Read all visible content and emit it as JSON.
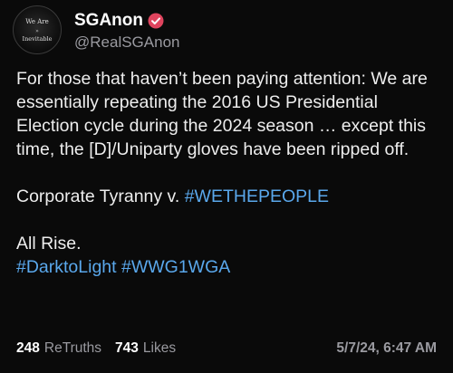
{
  "profile": {
    "display_name": "SGAnon",
    "handle": "@RealSGAnon",
    "avatar_text_top": "We Are",
    "avatar_text_mid": "»",
    "avatar_text_bottom": "Inevitable"
  },
  "post": {
    "paragraph_1": "For those that haven’t been paying attention: We are essentially repeating the 2016 US Presidential Election cycle during the 2024 season … except this time, the [D]/Uniparty gloves have been ripped off.",
    "paragraph_2_prefix": "Corporate Tyranny v. ",
    "paragraph_2_hashtag": "#WETHEPEOPLE",
    "paragraph_3": "All Rise.",
    "hashtag_1": "#DarktoLight",
    "hashtag_2": "#WWG1WGA"
  },
  "stats": {
    "retruths_count": "248",
    "retruths_label": "ReTruths",
    "likes_count": "743",
    "likes_label": "Likes",
    "timestamp": "5/7/24, 6:47 AM"
  },
  "colors": {
    "background": "#0a0a0a",
    "hashtag": "#5aa8ec",
    "verified_badge": "#e0445e"
  }
}
